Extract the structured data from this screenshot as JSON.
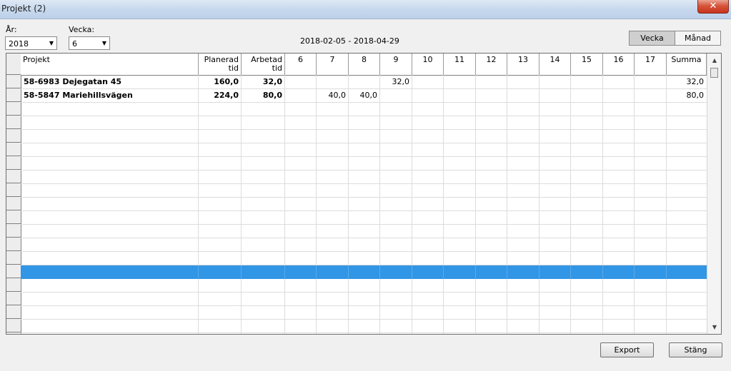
{
  "window": {
    "title": "Projekt (2)",
    "close_glyph": "✕"
  },
  "filters": {
    "year_label": "År:",
    "year_value": "2018",
    "week_label": "Vecka:",
    "week_value": "6"
  },
  "date_range": "2018-02-05 - 2018-04-29",
  "view_toggle": {
    "week": "Vecka",
    "month": "Månad",
    "selected": "Vecka"
  },
  "table": {
    "columns": [
      "Projekt",
      "Planerad\ntid",
      "Arbetad\ntid",
      "6",
      "7",
      "8",
      "9",
      "10",
      "11",
      "12",
      "13",
      "14",
      "15",
      "16",
      "17",
      "Summa"
    ],
    "rows": [
      [
        "58-6983 Dejegatan 45",
        "160,0",
        "32,0",
        "",
        "",
        "",
        "32,0",
        "",
        "",
        "",
        "",
        "",
        "",
        "",
        "",
        "32,0"
      ],
      [
        "58-5847 Mariehillsvägen",
        "224,0",
        "80,0",
        "",
        "40,0",
        "40,0",
        "",
        "",
        "",
        "",
        "",
        "",
        "",
        "",
        "",
        "80,0"
      ]
    ],
    "selected_row_index": 14
  },
  "footer": {
    "export_label": "Export",
    "close_label": "Stäng"
  },
  "colors": {
    "selection": "#3296e6",
    "titlebar": "#c9daee"
  },
  "icons": {
    "scroll_up": "▲",
    "scroll_down": "▼",
    "dropdown": "▼"
  }
}
